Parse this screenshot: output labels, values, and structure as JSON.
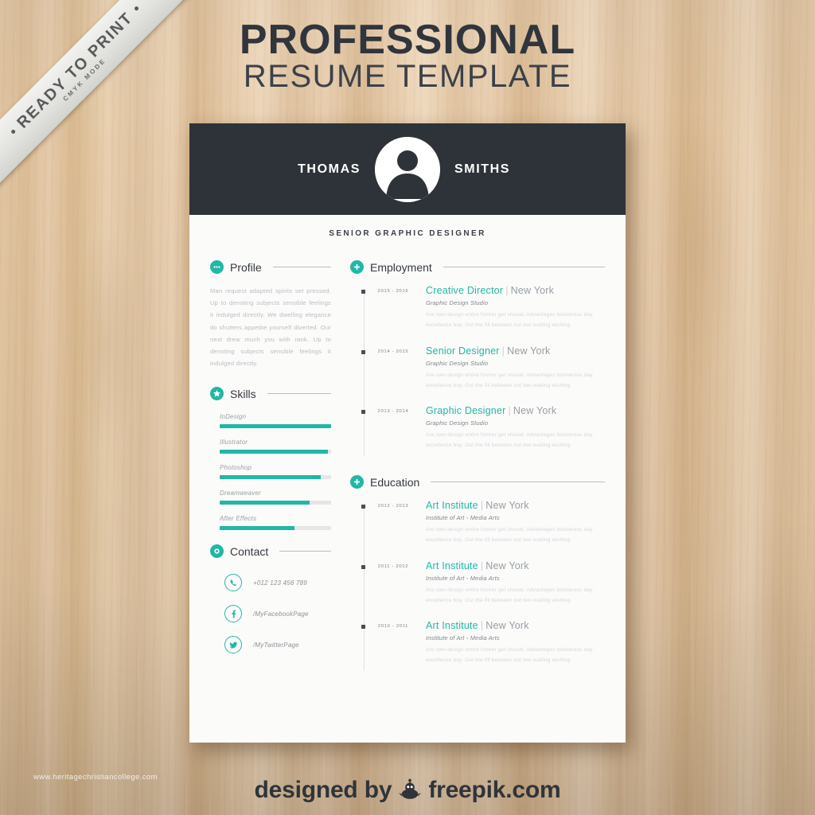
{
  "ribbon": {
    "label": "READY TO PRINT",
    "sub": "CMYK MODE"
  },
  "poster": {
    "title_main": "PROFESSIONAL",
    "title_sub": "RESUME TEMPLATE"
  },
  "resume": {
    "first_name": "THOMAS",
    "last_name": "SMITHS",
    "job_title": "SENIOR GRAPHIC DESIGNER",
    "avatar_icon": "user-avatar-icon"
  },
  "sidebar": {
    "profile": {
      "heading": "Profile",
      "icon": "dots-icon",
      "text": "Man request adapted spirits set pressed. Up to denoting subjects sensible feelings it indulged directly. We dwelling elegance do shutters appetite yourself diverted. Our next drew much you with rank. Up to denoting subjects sensible feelings it indulged directly."
    },
    "skills": {
      "heading": "Skills",
      "icon": "star-icon",
      "items": [
        {
          "label": "InDesign",
          "value": 100
        },
        {
          "label": "Illustrator",
          "value": 97
        },
        {
          "label": "Photoshop",
          "value": 91
        },
        {
          "label": "Dreamweaver",
          "value": 81
        },
        {
          "label": "After Effects",
          "value": 67
        }
      ]
    },
    "contact": {
      "heading": "Contact",
      "icon": "circle-icon",
      "items": [
        {
          "icon": "phone-icon",
          "text": "+012 123 456 789"
        },
        {
          "icon": "facebook-icon",
          "text": "/MyFacebookPage"
        },
        {
          "icon": "twitter-icon",
          "text": "/MyTwitterPage"
        }
      ]
    }
  },
  "main": {
    "employment": {
      "heading": "Employment",
      "icon": "plus-icon",
      "entries": [
        {
          "date": "2015 - 2016",
          "title": "Creative Director",
          "separator": "|",
          "place": "New York",
          "subtitle": "Graphic Design Studio",
          "description": "Are own design entire former get should. Advantages boisterous day excellence boy. Out the fill between out two waiting wishing"
        },
        {
          "date": "2014 - 2015",
          "title": "Senior Designer",
          "separator": "|",
          "place": "New York",
          "subtitle": "Graphic Design Studio",
          "description": "Are own design entire former get should. Advantages boisterous day excellence boy. Out the fill between out two waiting wishing"
        },
        {
          "date": "2013 - 2014",
          "title": "Graphic Designer",
          "separator": "|",
          "place": "New York",
          "subtitle": "Graphic Design Studio",
          "description": "Are own design entire former get should. Advantages boisterous day excellence boy. Out the fill between out two waiting wishing"
        }
      ]
    },
    "education": {
      "heading": "Education",
      "icon": "plus-icon",
      "entries": [
        {
          "date": "2012 - 2013",
          "title": "Art Institute",
          "separator": "|",
          "place": "New York",
          "subtitle": "Institute of Art - Media Arts",
          "description": "Are own design entire former get should. Advantages boisterous day excellence boy. Out the fill between out two waiting wishing"
        },
        {
          "date": "2011 - 2012",
          "title": "Art Institute",
          "separator": "|",
          "place": "New York",
          "subtitle": "Institute of Art - Media Arts",
          "description": "Are own design entire former get should. Advantages boisterous day excellence boy. Out the fill between out two waiting wishing"
        },
        {
          "date": "2010 - 2011",
          "title": "Art Institute",
          "separator": "|",
          "place": "New York",
          "subtitle": "Institute of Art - Media Arts",
          "description": "Are own design entire former get should. Advantages boisterous day excellence boy. Out the fill between out two waiting wishing"
        }
      ]
    }
  },
  "footer": {
    "text_before": "designed by",
    "text_after": "freepik.com",
    "logo_icon": "freepik-bird-icon"
  },
  "watermark": "www.heritagechristiancollege.com",
  "colors": {
    "accent": "#21b7a6",
    "header_dark": "#2e3339",
    "paper": "#fbfbfa",
    "title_dark": "#31353c",
    "wood": "#e2c5a2"
  }
}
